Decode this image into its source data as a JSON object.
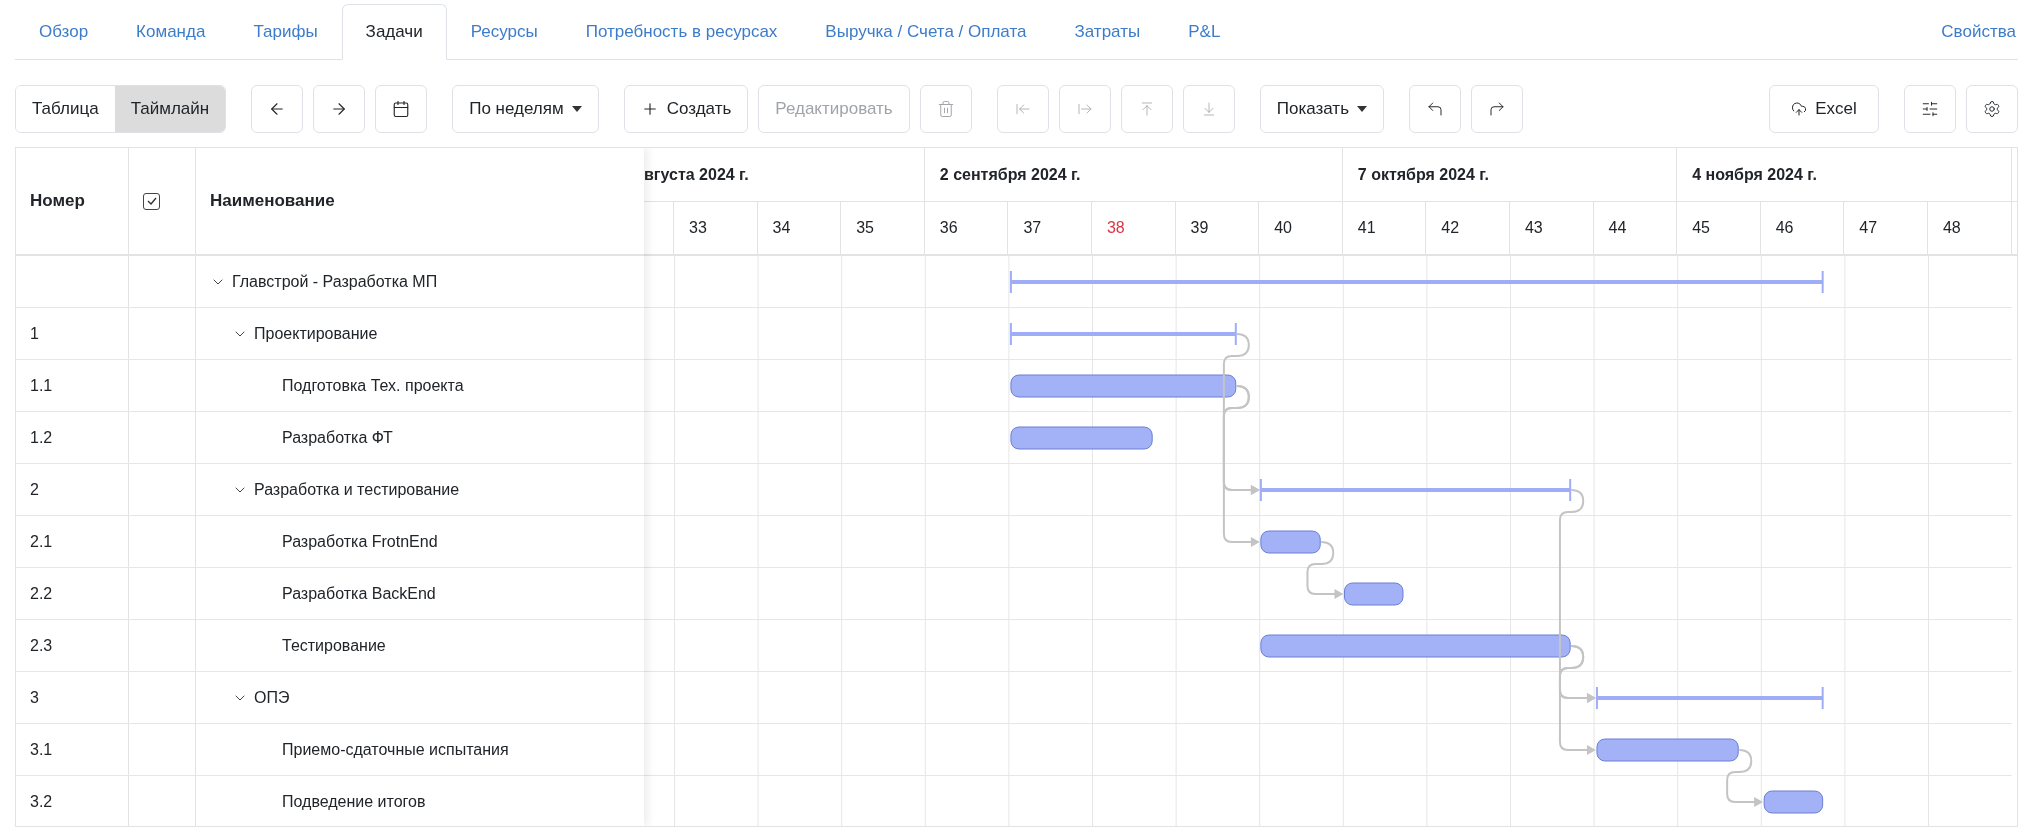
{
  "tabs": [
    {
      "label": "Обзор",
      "selected": false
    },
    {
      "label": "Команда",
      "selected": false
    },
    {
      "label": "Тарифы",
      "selected": false
    },
    {
      "label": "Задачи",
      "selected": true
    },
    {
      "label": "Ресурсы",
      "selected": false
    },
    {
      "label": "Потребность в ресурсах",
      "selected": false
    },
    {
      "label": "Выручка / Счета / Оплата",
      "selected": false
    },
    {
      "label": "Затраты",
      "selected": false
    },
    {
      "label": "P&L",
      "selected": false
    }
  ],
  "properties_link": "Свойства",
  "toolbar": {
    "view_toggle": [
      {
        "label": "Таблица",
        "selected": false
      },
      {
        "label": "Таймлайн",
        "selected": true
      }
    ],
    "scale_dropdown": "По неделям",
    "create_button": "Создать",
    "edit_button": {
      "label": "Редактировать",
      "disabled": true
    },
    "delete_disabled": true,
    "move_buttons_disabled": true,
    "show_dropdown": "Показать",
    "excel_button": "Excel"
  },
  "table": {
    "columns": [
      "Номер",
      "Наименование"
    ],
    "header_checkbox_checked": true,
    "tasks": [
      {
        "name": "Главстрой - Разработка МП",
        "kind": "summary",
        "expanded": true,
        "children": [
          {
            "number": "1",
            "name": "Проектирование",
            "kind": "summary",
            "expanded": true,
            "children": [
              {
                "number": "1.1",
                "name": "Подготовка Тех. проекта",
                "kind": "task"
              },
              {
                "number": "1.2",
                "name": "Разработка ФТ",
                "kind": "task"
              }
            ]
          },
          {
            "number": "2",
            "name": "Разработка и тестирование",
            "kind": "summary",
            "expanded": true,
            "children": [
              {
                "number": "2.1",
                "name": "Разработка FrotnEnd",
                "kind": "task"
              },
              {
                "number": "2.2",
                "name": "Разработка BackEnd",
                "kind": "task"
              },
              {
                "number": "2.3",
                "name": "Тестирование",
                "kind": "task"
              }
            ]
          },
          {
            "number": "3",
            "name": "ОПЭ",
            "kind": "summary",
            "expanded": true,
            "children": [
              {
                "number": "3.1",
                "name": "Приемо-сдаточные испытания",
                "kind": "task"
              },
              {
                "number": "3.2",
                "name": "Подведение итогов",
                "kind": "task"
              }
            ]
          }
        ]
      }
    ]
  },
  "timeline": {
    "months": [
      {
        "label": "вгуста 2024 г.",
        "weeks": [
          {
            "label": "33",
            "current": false
          },
          {
            "label": "34",
            "current": false
          },
          {
            "label": "35",
            "current": false
          }
        ]
      },
      {
        "label": "2 сентября 2024 г.",
        "weeks": [
          {
            "label": "36",
            "current": false
          },
          {
            "label": "37",
            "current": false
          },
          {
            "label": "38",
            "current": true
          },
          {
            "label": "39",
            "current": false
          },
          {
            "label": "40",
            "current": false
          }
        ]
      },
      {
        "label": "7 октября 2024 г.",
        "weeks": [
          {
            "label": "41",
            "current": false
          },
          {
            "label": "42",
            "current": false
          },
          {
            "label": "43",
            "current": false
          },
          {
            "label": "44",
            "current": false
          }
        ]
      },
      {
        "label": "4 ноября 2024 г.",
        "weeks": [
          {
            "label": "45",
            "current": false
          },
          {
            "label": "46",
            "current": false
          },
          {
            "label": "47",
            "current": false
          },
          {
            "label": "48",
            "current": false
          }
        ]
      }
    ]
  }
}
